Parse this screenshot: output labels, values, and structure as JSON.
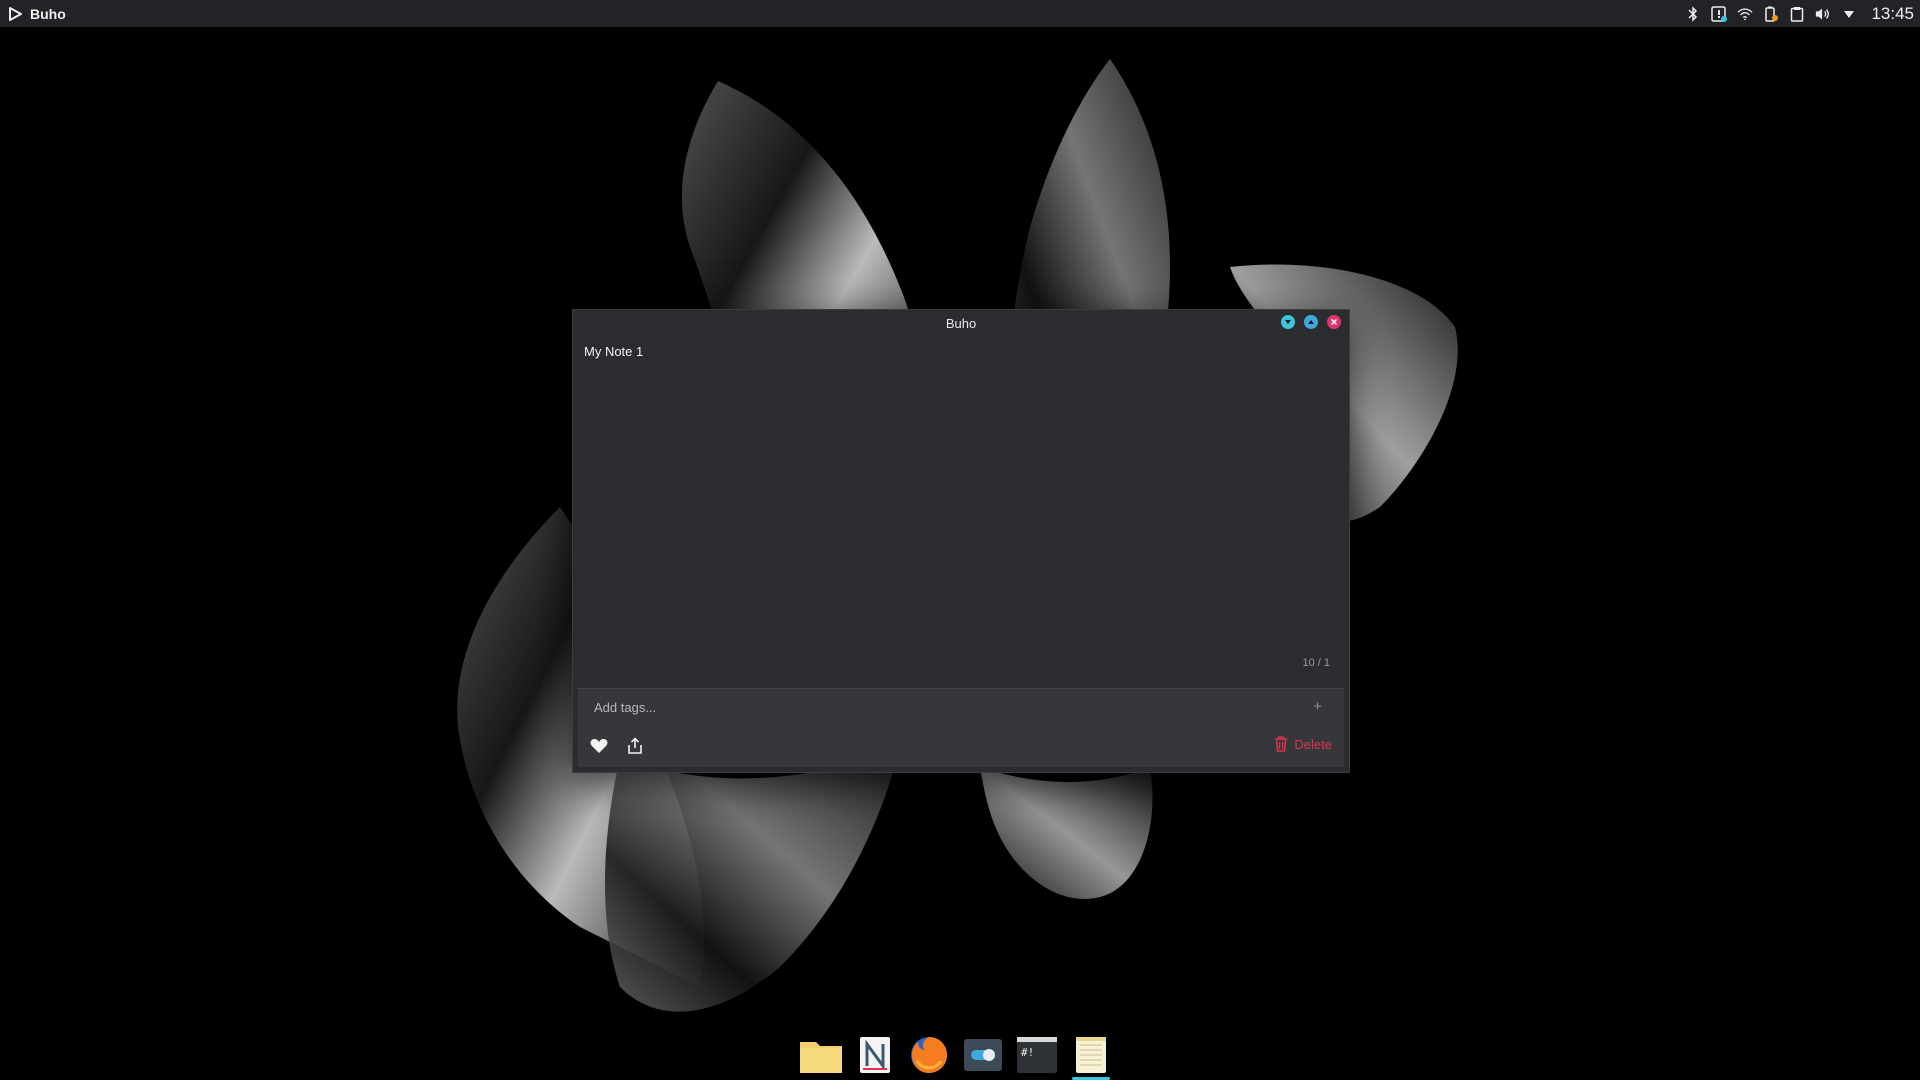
{
  "topbar": {
    "app_name": "Buho",
    "clock": "13:45",
    "tray_icons": [
      "bluetooth-icon",
      "notification-icon",
      "wifi-icon",
      "battery-icon",
      "clipboard-icon",
      "volume-icon",
      "menu-arrow-icon"
    ]
  },
  "window": {
    "title": "Buho",
    "note_text": "My Note 1",
    "counter": "10 / 1",
    "tags_placeholder": "Add tags...",
    "add_tag_label": "+",
    "delete_label": "Delete"
  },
  "dock": {
    "items": [
      "files",
      "notes-app",
      "firefox",
      "settings-toggle",
      "terminal",
      "buho-notes"
    ],
    "active": "buho-notes"
  },
  "colors": {
    "accent": "#3fc4de",
    "danger": "#e0334b",
    "window_bg": "#2b2c30",
    "panel_bg": "#222326"
  }
}
